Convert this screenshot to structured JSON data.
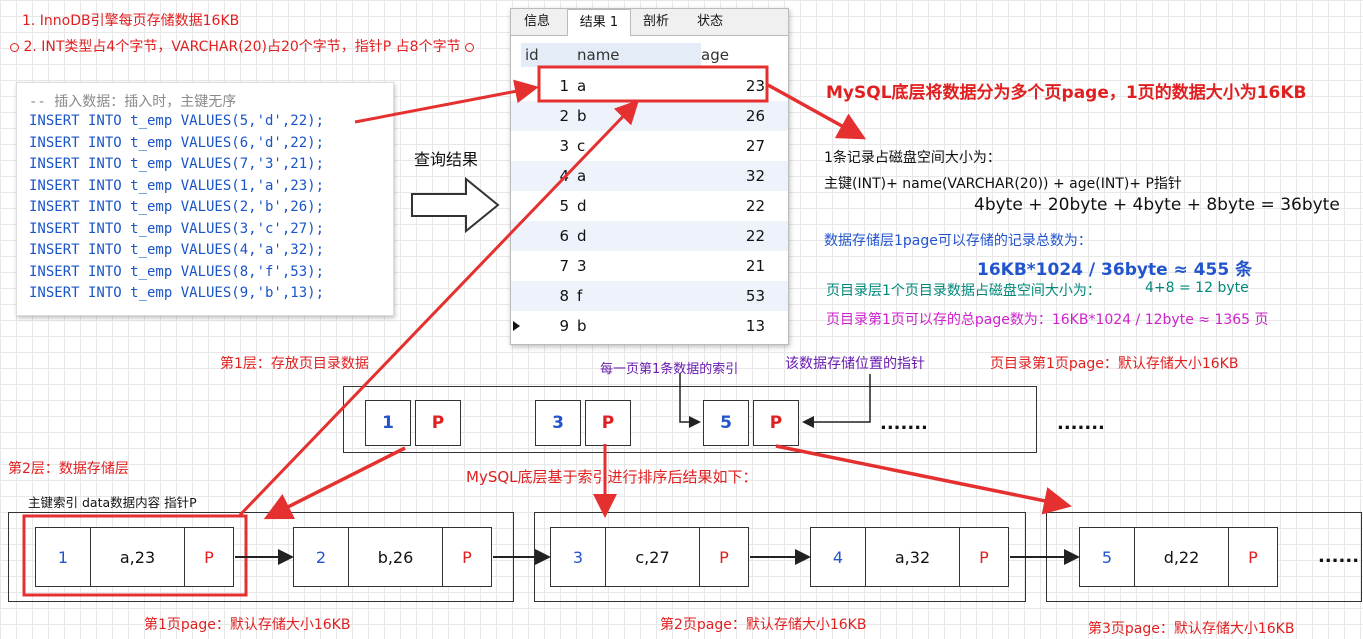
{
  "notes": {
    "line1": "1. InnoDB引擎每页存储数据16KB",
    "line2": "2. INT类型占4个字节，VARCHAR(20)占20个字节，指针P 占8个字节"
  },
  "code": {
    "comment": "-- 插入数据：插入时，主键无序",
    "lines": [
      "INSERT INTO t_emp VALUES(5,'d',22);",
      "INSERT INTO t_emp VALUES(6,'d',22);",
      "INSERT INTO t_emp VALUES(7,'3',21);",
      "INSERT INTO t_emp VALUES(1,'a',23);",
      "INSERT INTO t_emp VALUES(2,'b',26);",
      "INSERT INTO t_emp VALUES(3,'c',27);",
      "INSERT INTO t_emp VALUES(4,'a',32);",
      "INSERT INTO t_emp VALUES(8,'f',53);",
      "INSERT INTO t_emp VALUES(9,'b',13);"
    ]
  },
  "query_label": "查询结果",
  "result": {
    "tabs": [
      "信息",
      "结果 1",
      "剖析",
      "状态"
    ],
    "columns": [
      "id",
      "name",
      "age"
    ],
    "rows": [
      [
        "1",
        "a",
        "23"
      ],
      [
        "2",
        "b",
        "26"
      ],
      [
        "3",
        "c",
        "27"
      ],
      [
        "4",
        "a",
        "32"
      ],
      [
        "5",
        "d",
        "22"
      ],
      [
        "6",
        "d",
        "22"
      ],
      [
        "7",
        "3",
        "21"
      ],
      [
        "8",
        "f",
        "53"
      ],
      [
        "9",
        "b",
        "13"
      ]
    ]
  },
  "right_notes": {
    "title": "MySQL底层将数据分为多个页page，1页的数据大小为16KB",
    "rec_size_label": "1条记录占磁盘空间大小为：",
    "rec_formula": "主键(INT)+ name(VARCHAR(20)) + age(INT)+ P指针",
    "rec_sum": "4byte + 20byte + 4byte + 8byte = 36byte",
    "page_count_label": "数据存储层1page可以存储的记录总数为：",
    "page_count": "16KB*1024 / 36byte ≈ 455 条",
    "dir_size": "页目录层1个页目录数据占磁盘空间大小为：",
    "dir_size_val": "4+8 = 12 byte",
    "dir_pages": "页目录第1页可以存的总page数为：16KB*1024 / 12byte  ≈ 1365 页"
  },
  "layer1": {
    "label": "第1层：存放页目录数据",
    "index_label": "每一页第1条数据的索引",
    "pointer_label": "该数据存储位置的指针",
    "page_label": "页目录第1页page：默认存储大小16KB",
    "entries": [
      {
        "key": "1",
        "ptr": "P"
      },
      {
        "key": "3",
        "ptr": "P"
      },
      {
        "key": "5",
        "ptr": "P"
      }
    ],
    "ellipsis1": ".......",
    "ellipsis2": "......."
  },
  "layer2": {
    "label": "第2层：数据存储层",
    "sort_label": "MySQL底层基于索引进行排序后结果如下：",
    "legend": "主键索引   data数据内容    指针P",
    "pages": [
      {
        "label": "第1页page：默认存储大小16KB",
        "records": [
          {
            "key": "1",
            "data": "a,23",
            "ptr": "P"
          },
          {
            "key": "2",
            "data": "b,26",
            "ptr": "P"
          }
        ]
      },
      {
        "label": "第2页page：默认存储大小16KB",
        "records": [
          {
            "key": "3",
            "data": "c,27",
            "ptr": "P"
          },
          {
            "key": "4",
            "data": "a,32",
            "ptr": "P"
          }
        ]
      },
      {
        "label": "第3页page：默认存储大小16KB",
        "records": [
          {
            "key": "5",
            "data": "d,22",
            "ptr": "P"
          }
        ]
      }
    ],
    "ellipsis": "......"
  },
  "colors": {
    "red": "#e02020",
    "blue": "#2255cc",
    "teal": "#00897b",
    "magenta": "#cc22cc",
    "purple": "#6a1bb0"
  }
}
